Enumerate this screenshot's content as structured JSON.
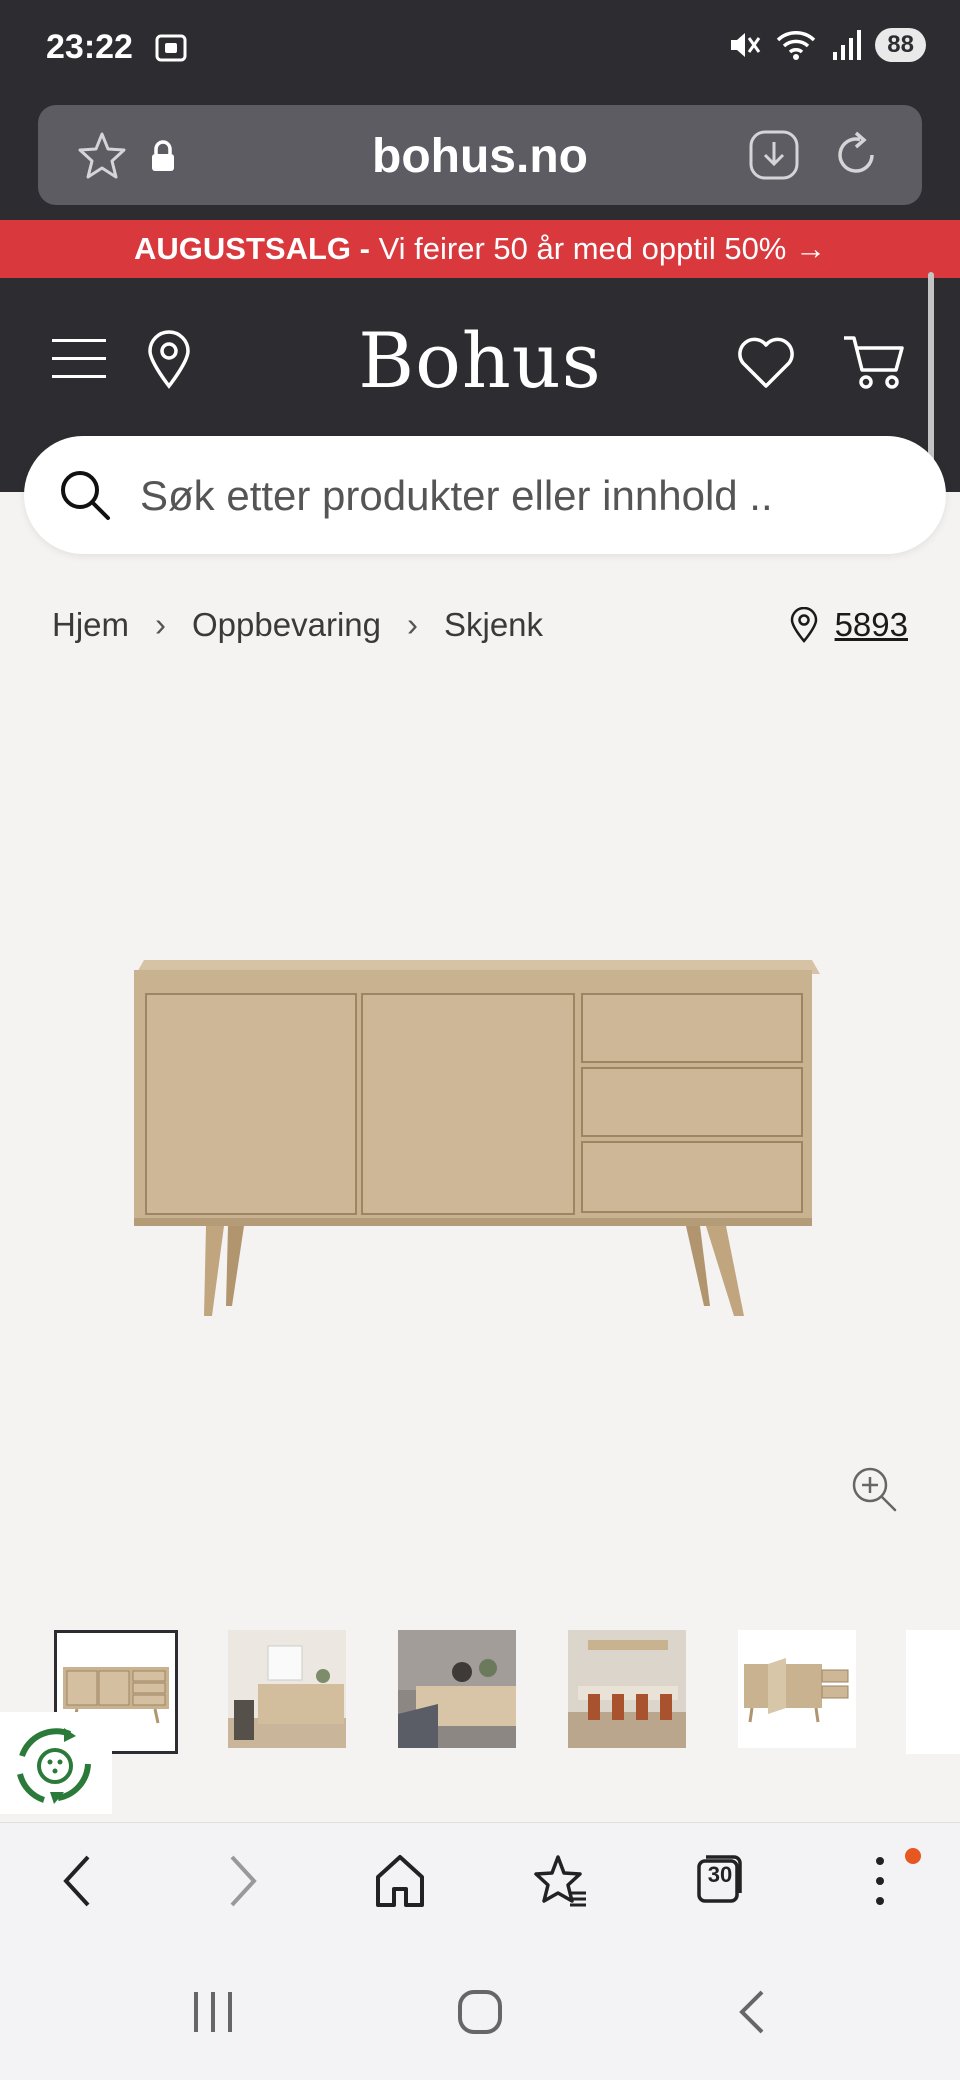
{
  "status_bar": {
    "time": "23:22",
    "battery": "88"
  },
  "browser": {
    "url": "bohus.no",
    "tab_count": "30"
  },
  "promo": {
    "bold": "AUGUSTSALG -",
    "text": "Vi feirer 50 år med opptil 50% →"
  },
  "header": {
    "logo": "Bohus"
  },
  "search": {
    "placeholder": "Søk etter produkter eller innhold .."
  },
  "breadcrumb": {
    "items": [
      "Hjem",
      "Oppbevaring",
      "Skjenk"
    ],
    "separator": "›"
  },
  "store": {
    "number": "5893"
  },
  "product": {
    "image_name": "sideboard-oak",
    "thumbnail_count": 5
  },
  "colors": {
    "header_bg": "#2d2d31",
    "promo_bg": "#d9383c",
    "page_bg": "#f5f3f1",
    "oak": "#c9b290"
  }
}
